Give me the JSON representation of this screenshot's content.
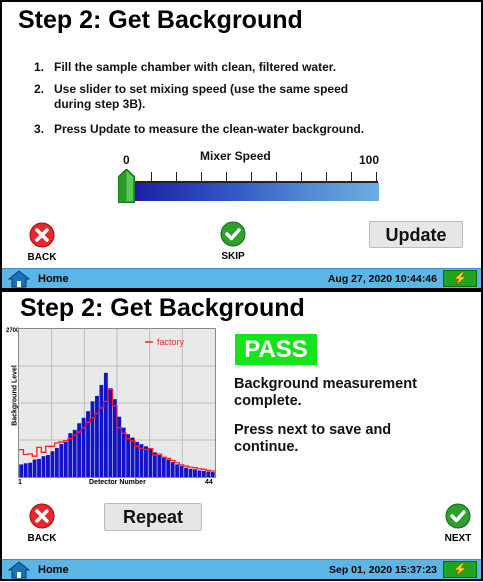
{
  "panel1": {
    "title": "Step 2: Get Background",
    "steps": [
      {
        "num": "1.",
        "text": "Fill the sample chamber with clean, filtered water."
      },
      {
        "num": "2.",
        "text": "Use slider to set mixing speed (use the same speed during step 3B)."
      },
      {
        "num": "3.",
        "text": "Press Update to measure the clean-water background."
      }
    ],
    "slider": {
      "label": "Mixer Speed",
      "min": "0",
      "max": "100",
      "value": 0
    },
    "back_label": "BACK",
    "skip_label": "SKIP",
    "update_label": "Update",
    "status": {
      "home_label": "Home",
      "datetime": "Aug 27, 2020  10:44:46"
    }
  },
  "panel2": {
    "title": "Step 2: Get Background",
    "pass_label": "PASS",
    "message1": "Background measurement complete.",
    "message2": "Press next to save and continue.",
    "repeat_label": "Repeat",
    "back_label": "BACK",
    "next_label": "NEXT",
    "status": {
      "home_label": "Home",
      "datetime": "Sep 01, 2020  15:37:23"
    }
  },
  "chart_data": {
    "type": "bar",
    "ylabel": "Background Level",
    "xlabel": "Detector Number",
    "ymax_label": "2700",
    "xmin_label": "1",
    "xmax_label": "44",
    "ylim": [
      0,
      2700
    ],
    "x": [
      1,
      2,
      3,
      4,
      5,
      6,
      7,
      8,
      9,
      10,
      11,
      12,
      13,
      14,
      15,
      16,
      17,
      18,
      19,
      20,
      21,
      22,
      23,
      24,
      25,
      26,
      27,
      28,
      29,
      30,
      31,
      32,
      33,
      34,
      35,
      36,
      37,
      38,
      39,
      40,
      41,
      42,
      43,
      44
    ],
    "series": [
      {
        "name": "",
        "type": "bar",
        "color": "#1212c8",
        "values": [
          230,
          250,
          260,
          320,
          330,
          380,
          400,
          470,
          530,
          600,
          640,
          800,
          860,
          980,
          1080,
          1200,
          1380,
          1480,
          1680,
          1900,
          1620,
          1420,
          1100,
          900,
          780,
          720,
          640,
          600,
          560,
          520,
          450,
          400,
          360,
          320,
          270,
          230,
          200,
          170,
          150,
          140,
          120,
          110,
          100,
          90
        ]
      },
      {
        "name": "factory",
        "type": "line",
        "color": "#ff2020",
        "values": [
          500,
          410,
          420,
          380,
          540,
          450,
          560,
          560,
          620,
          640,
          660,
          700,
          760,
          820,
          900,
          1000,
          1080,
          1160,
          1260,
          1380,
          1600,
          1300,
          900,
          800,
          700,
          660,
          560,
          520,
          500,
          520,
          400,
          420,
          360,
          340,
          300,
          260,
          220,
          200,
          180,
          170,
          150,
          140,
          120,
          110
        ]
      }
    ],
    "grid": true,
    "legend_position": "top-right"
  },
  "colors": {
    "status_bar": "#5bb6e6",
    "pass_green": "#17e31a",
    "back_red": "#e8262d",
    "check_green": "#2fa02f"
  }
}
